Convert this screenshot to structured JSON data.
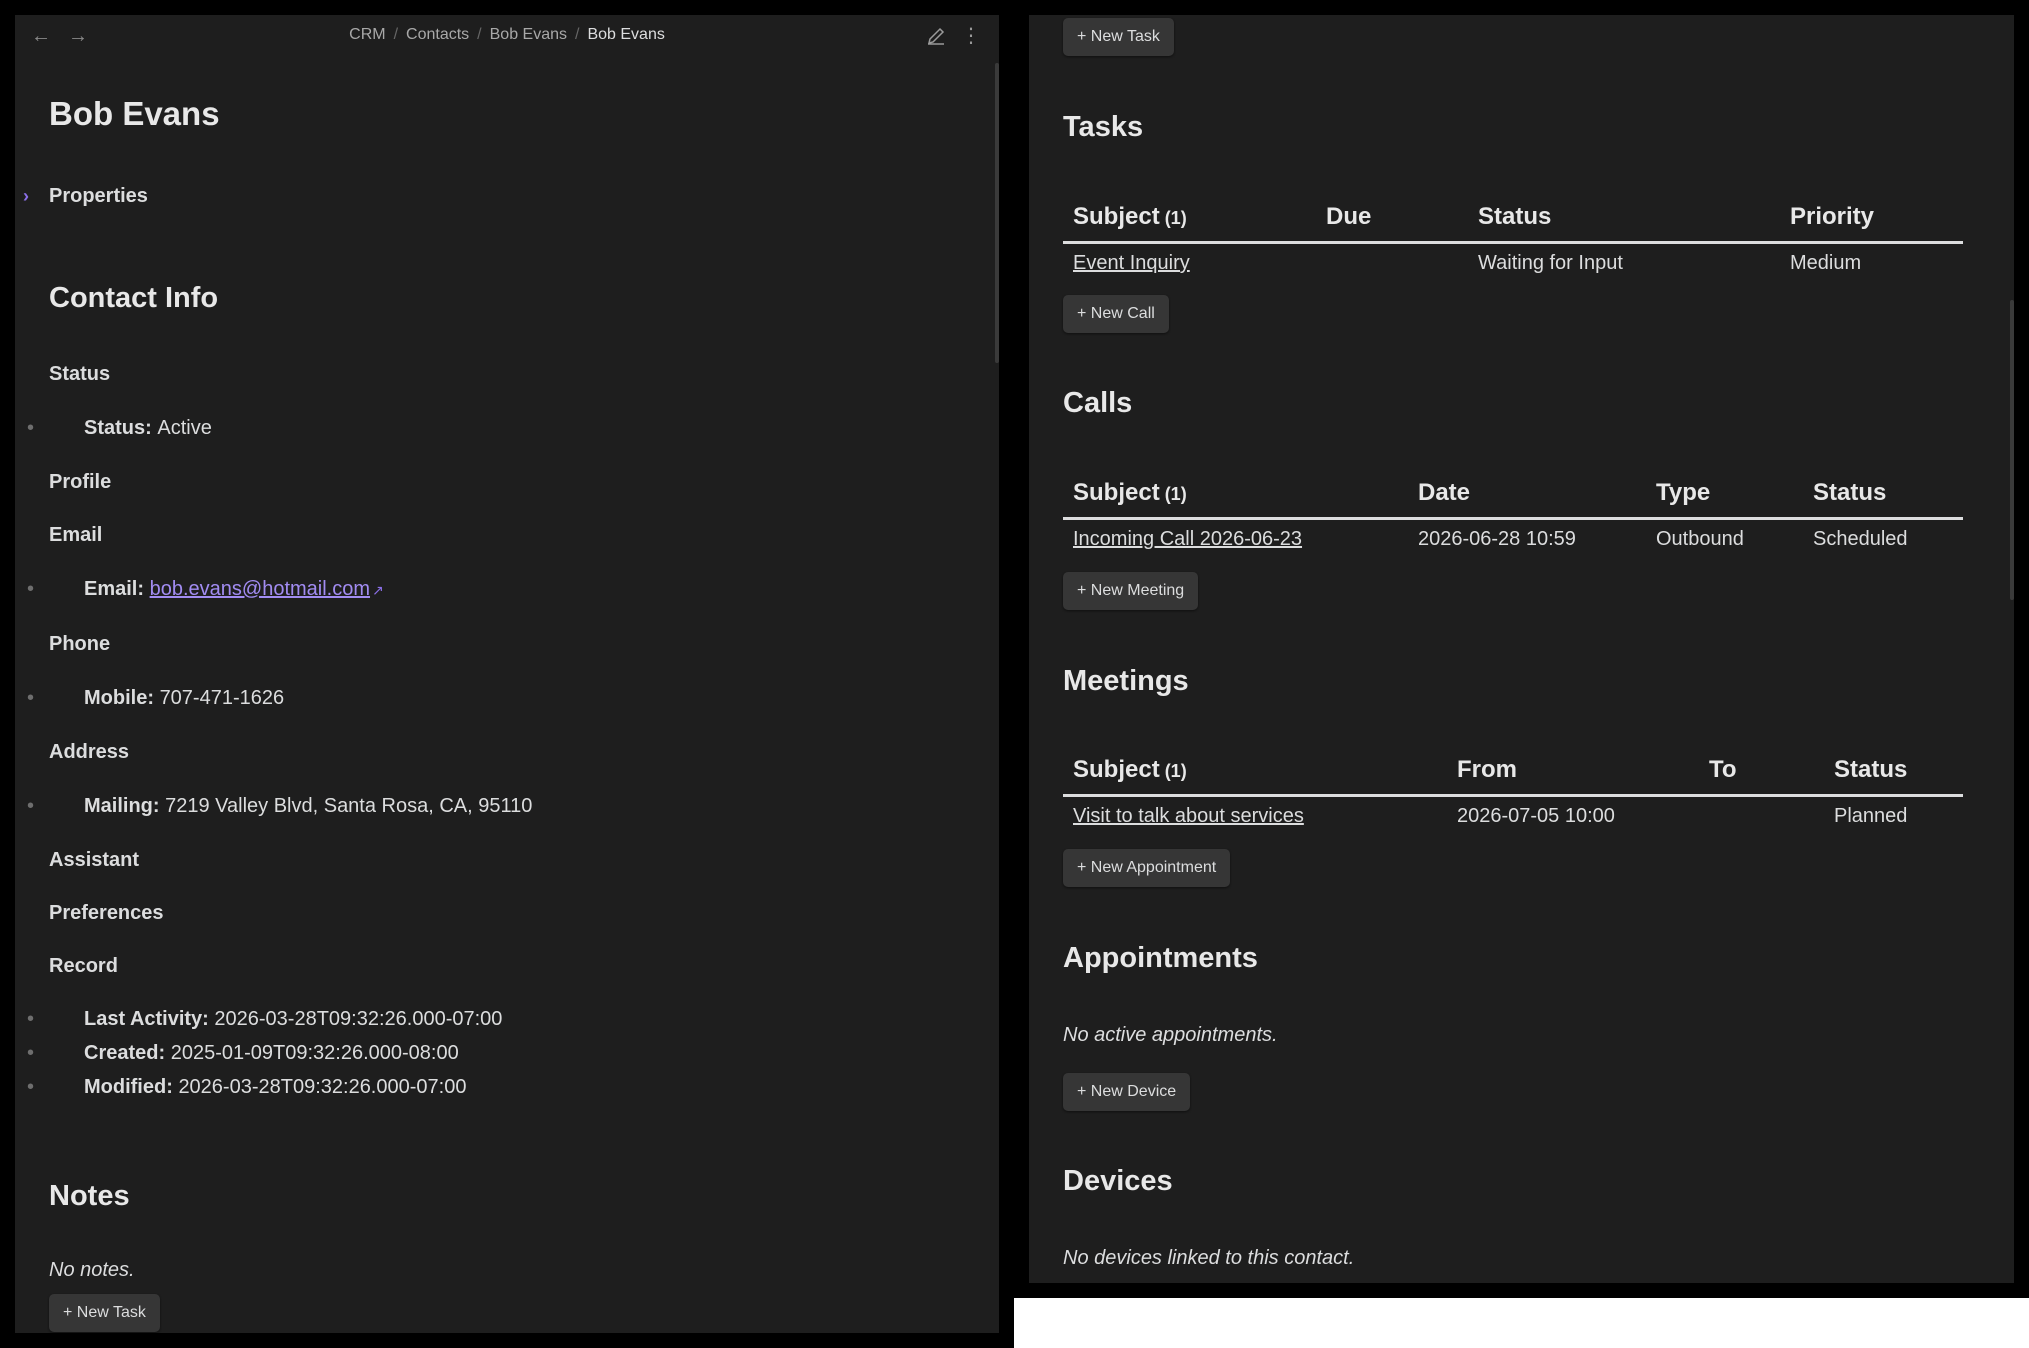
{
  "breadcrumb": {
    "items": [
      "CRM",
      "Contacts",
      "Bob Evans"
    ],
    "current": "Bob Evans",
    "separator": "/"
  },
  "icons": {
    "back": "arrow-left-icon",
    "forward": "arrow-right-icon",
    "edit": "pencil-icon",
    "more": "vertical-dots-icon",
    "external": "external-link-icon"
  },
  "colors": {
    "background": "#1e1e1e",
    "accent": "#a28cf2",
    "button": "#363636",
    "text": "#dcddde"
  },
  "left": {
    "title": "Bob Evans",
    "properties_label": "Properties",
    "contact_info_heading": "Contact Info",
    "status_heading": "Status",
    "status_key": "Status:",
    "status_value": "Active",
    "profile_heading": "Profile",
    "email_heading": "Email",
    "email_key": "Email:",
    "email_value": "bob.evans@hotmail.com",
    "phone_heading": "Phone",
    "mobile_key": "Mobile:",
    "mobile_value": "707-471-1626",
    "address_heading": "Address",
    "mailing_key": "Mailing:",
    "mailing_value": "7219 Valley Blvd, Santa Rosa, CA, 95110",
    "assistant_heading": "Assistant",
    "preferences_heading": "Preferences",
    "record_heading": "Record",
    "last_activity_key": "Last Activity:",
    "last_activity_value": "2026-03-28T09:32:26.000-07:00",
    "created_key": "Created:",
    "created_value": "2025-01-09T09:32:26.000-08:00",
    "modified_key": "Modified:",
    "modified_value": "2026-03-28T09:32:26.000-07:00",
    "notes_heading": "Notes",
    "notes_empty": "No notes.",
    "new_task_button": "+ New Task"
  },
  "right": {
    "new_task_button": "+ New Task",
    "tasks": {
      "heading": "Tasks",
      "columns": [
        "Subject",
        "Due",
        "Status",
        "Priority"
      ],
      "count": "(1)",
      "rows": [
        {
          "subject": "Event Inquiry",
          "due": "",
          "status": "Waiting for Input",
          "priority": "Medium"
        }
      ]
    },
    "new_call_button": "+ New Call",
    "calls": {
      "heading": "Calls",
      "columns": [
        "Subject",
        "Date",
        "Type",
        "Status"
      ],
      "count": "(1)",
      "rows": [
        {
          "subject": "Incoming Call 2026-06-23",
          "date": "2026-06-28 10:59",
          "type": "Outbound",
          "status": "Scheduled"
        }
      ]
    },
    "new_meeting_button": "+ New Meeting",
    "meetings": {
      "heading": "Meetings",
      "columns": [
        "Subject",
        "From",
        "To",
        "Status"
      ],
      "count": "(1)",
      "rows": [
        {
          "subject": "Visit to talk about services",
          "from": "2026-07-05 10:00",
          "to": "",
          "status": "Planned"
        }
      ]
    },
    "new_appointment_button": "+ New Appointment",
    "appointments": {
      "heading": "Appointments",
      "empty": "No active appointments."
    },
    "new_device_button": "+ New Device",
    "devices": {
      "heading": "Devices",
      "empty": "No devices linked to this contact."
    }
  }
}
